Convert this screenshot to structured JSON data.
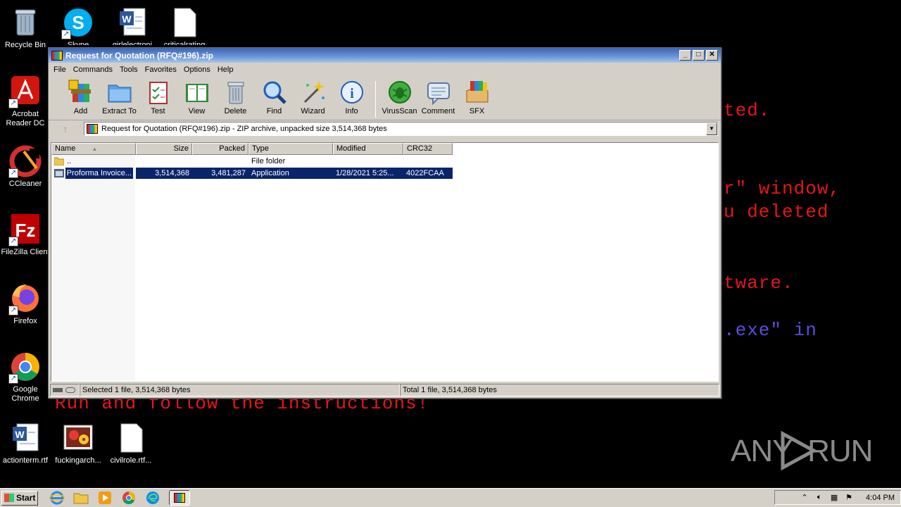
{
  "desktop": {
    "background_text": [
      {
        "text": "ted.",
        "color": "#e8141a"
      },
      {
        "text": "r\" window,",
        "color": "#e8141a"
      },
      {
        "text": "u deleted",
        "color": "#e8141a"
      },
      {
        "text": "tware.",
        "color": "#e8141a"
      },
      {
        "text": ".exe\" in",
        "color": "#5a4de0"
      },
      {
        "text": "Run and follow the instructions!",
        "color": "#e8141a"
      }
    ],
    "icons": [
      {
        "label": "Recycle Bin",
        "icon": "recycle-bin-icon"
      },
      {
        "label": "Skype",
        "icon": "skype-icon"
      },
      {
        "label": "girlelectroni",
        "icon": "word-document-icon"
      },
      {
        "label": "criticalrating",
        "icon": "blank-file-icon"
      },
      {
        "label": "Acrobat Reader DC",
        "icon": "acrobat-icon"
      },
      {
        "label": "CCleaner",
        "icon": "ccleaner-icon"
      },
      {
        "label": "FileZilla Client",
        "icon": "filezilla-icon"
      },
      {
        "label": "Firefox",
        "icon": "firefox-icon"
      },
      {
        "label": "Google Chrome",
        "icon": "chrome-icon"
      },
      {
        "label": "actionterm.rtf",
        "icon": "word-document-icon"
      },
      {
        "label": "fuckingarch...",
        "icon": "image-file-icon"
      },
      {
        "label": "civilrole.rtf...",
        "icon": "blank-file-icon"
      }
    ],
    "watermark": "ANY  RUN"
  },
  "window": {
    "title": "Request for Quotation (RFQ#196).zip",
    "controls": {
      "minimize": "_",
      "maximize": "□",
      "close": "✕"
    },
    "menu": [
      "File",
      "Commands",
      "Tools",
      "Favorites",
      "Options",
      "Help"
    ],
    "toolbar": [
      {
        "label": "Add",
        "icon": "add-archive-icon"
      },
      {
        "label": "Extract To",
        "icon": "extract-folder-icon"
      },
      {
        "label": "Test",
        "icon": "test-checklist-icon"
      },
      {
        "label": "View",
        "icon": "view-book-icon"
      },
      {
        "label": "Delete",
        "icon": "delete-trash-icon"
      },
      {
        "label": "Find",
        "icon": "find-magnifier-icon"
      },
      {
        "label": "Wizard",
        "icon": "wizard-wand-icon"
      },
      {
        "label": "Info",
        "icon": "info-icon"
      },
      {
        "label": "VirusScan",
        "icon": "virus-scan-icon"
      },
      {
        "label": "Comment",
        "icon": "comment-icon"
      },
      {
        "label": "SFX",
        "icon": "sfx-box-icon"
      }
    ],
    "address": "Request for Quotation (RFQ#196).zip - ZIP archive, unpacked size 3,514,368 bytes",
    "columns": [
      "Name",
      "Size",
      "Packed",
      "Type",
      "Modified",
      "CRC32"
    ],
    "rows": [
      {
        "name": "..",
        "size": "",
        "packed": "",
        "type": "File folder",
        "modified": "",
        "crc": "",
        "selected": false
      },
      {
        "name": "Proforma Invoice...",
        "size": "3,514,368",
        "packed": "3,481,287",
        "type": "Application",
        "modified": "1/28/2021 5:25...",
        "crc": "4022FCAA",
        "selected": true
      }
    ],
    "status_left": "Selected 1 file, 3,514,368 bytes",
    "status_right": "Total 1 file, 3,514,368 bytes"
  },
  "taskbar": {
    "start_label": "Start",
    "quick_launch": [
      "ie-icon",
      "explorer-icon",
      "media-player-icon",
      "chrome-icon",
      "edge-icon",
      "winrar-icon"
    ],
    "clock": "4:04 PM"
  }
}
